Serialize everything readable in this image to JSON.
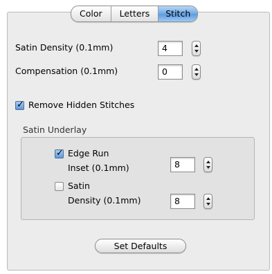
{
  "tabs": [
    {
      "label": "Color",
      "selected": false
    },
    {
      "label": "Letters",
      "selected": false
    },
    {
      "label": "Stitch",
      "selected": true
    }
  ],
  "satin_density": {
    "label": "Satin Density (0.1mm)",
    "value": "4"
  },
  "compensation": {
    "label": "Compensation (0.1mm)",
    "value": "0"
  },
  "remove_hidden": {
    "label": "Remove Hidden Stitches",
    "checked": true
  },
  "satin_underlay": {
    "title": "Satin Underlay",
    "edge_run": {
      "label": "Edge Run",
      "checked": true,
      "inset_label": "Inset (0.1mm)",
      "inset_value": "8"
    },
    "satin": {
      "label": "Satin",
      "checked": false,
      "density_label": "Density (0.1mm)",
      "density_value": "8"
    }
  },
  "set_defaults_label": "Set Defaults"
}
